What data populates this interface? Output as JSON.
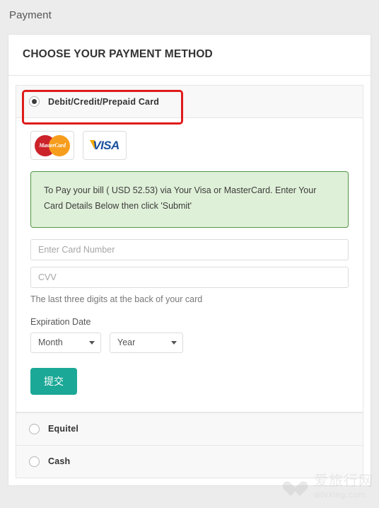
{
  "page": {
    "title": "Payment"
  },
  "panel": {
    "heading": "CHOOSE YOUR PAYMENT METHOD"
  },
  "methods": [
    {
      "label": "Debit/Credit/Prepaid Card",
      "selected": true,
      "highlighted": true
    },
    {
      "label": "Equitel",
      "selected": false,
      "highlighted": false
    },
    {
      "label": "Cash",
      "selected": false,
      "highlighted": false
    }
  ],
  "card_form": {
    "logos": [
      {
        "name": "mastercard-logo",
        "text": "MasterCard"
      },
      {
        "name": "visa-logo",
        "text": "VISA"
      }
    ],
    "alert_text": "To Pay your bill ( USD 52.53) via Your Visa or MasterCard. Enter Your Card Details Below then click 'Submit'",
    "amount": "USD 52.53",
    "card_number_placeholder": "Enter Card Number",
    "card_number_value": "",
    "cvv_placeholder": "CVV",
    "cvv_value": "",
    "cvv_help": "The last three digits at the back of your card",
    "expiration_label": "Expiration Date",
    "month_selected": "Month",
    "year_selected": "Year",
    "submit_label": "提交"
  },
  "watermark": {
    "cn": "爱旅行网",
    "en": "ailvxing.com"
  },
  "colors": {
    "page_bg": "#ececec",
    "panel_bg": "#ffffff",
    "row_bg": "#f8f8f8",
    "alert_bg": "#dff0d8",
    "alert_border": "#539648",
    "submit_bg": "#1ba896",
    "highlight_ring": "#e01b1b",
    "mastercard_red": "#cc2229",
    "mastercard_orange": "#f79d1d",
    "visa_blue": "#1a4f9c",
    "visa_gold": "#f2a900"
  }
}
